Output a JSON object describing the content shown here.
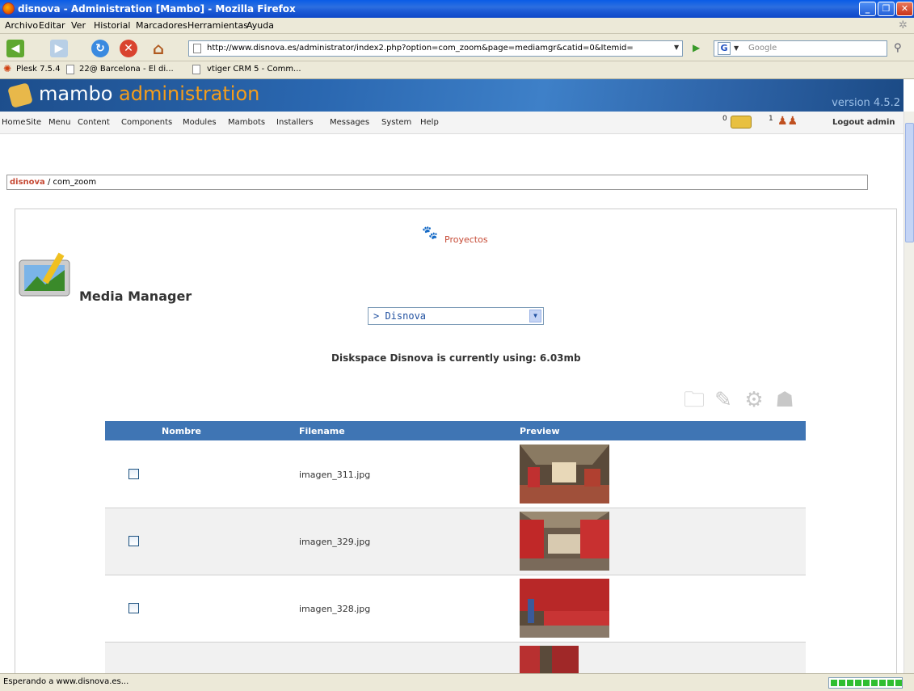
{
  "window": {
    "title": "disnova - Administration [Mambo] - Mozilla Firefox"
  },
  "browser_menu": [
    "Archivo",
    "Editar",
    "Ver",
    "Historial",
    "Marcadores",
    "Herramientas",
    "Ayuda"
  ],
  "navigation": {
    "url": "http://www.disnova.es/administrator/index2.php?option=com_zoom&page=mediamgr&catid=0&Itemid=",
    "search_placeholder": "Google"
  },
  "bookmarks": [
    "Plesk 7.5.4",
    "22@ Barcelona - El di...",
    "vtiger CRM 5 - Comm..."
  ],
  "mambo": {
    "brand_main": "mambo",
    "brand_accent": "administration",
    "version": "version 4.5.2",
    "menu": [
      "Home",
      "Site",
      "Menu",
      "Content",
      "Components",
      "Modules",
      "Mambots",
      "Installers",
      "Messages",
      "System",
      "Help"
    ],
    "messages_count": "0",
    "users_count": "1",
    "logout": "Logout admin",
    "path_site": "disnova",
    "path_rest": "/ com_zoom"
  },
  "page": {
    "title": "Media Manager",
    "category_link": "Proyectos",
    "gallery_select": "> Disnova",
    "diskspace": "Diskspace Disnova is currently using: 6.03mb"
  },
  "table": {
    "headers": [
      "Nombre",
      "Filename",
      "Preview"
    ],
    "rows": [
      {
        "filename": "imagen_311.jpg"
      },
      {
        "filename": "imagen_329.jpg"
      },
      {
        "filename": "imagen_328.jpg"
      }
    ]
  },
  "status": {
    "text": "Esperando a www.disnova.es...",
    "progress": 1.0
  },
  "colors": {
    "titlebar": "#0a5ce6",
    "mambo_header": "#2a67b0",
    "accent_orange": "#f59d1a",
    "table_header": "#3f75b4",
    "link_red": "#c64934"
  }
}
